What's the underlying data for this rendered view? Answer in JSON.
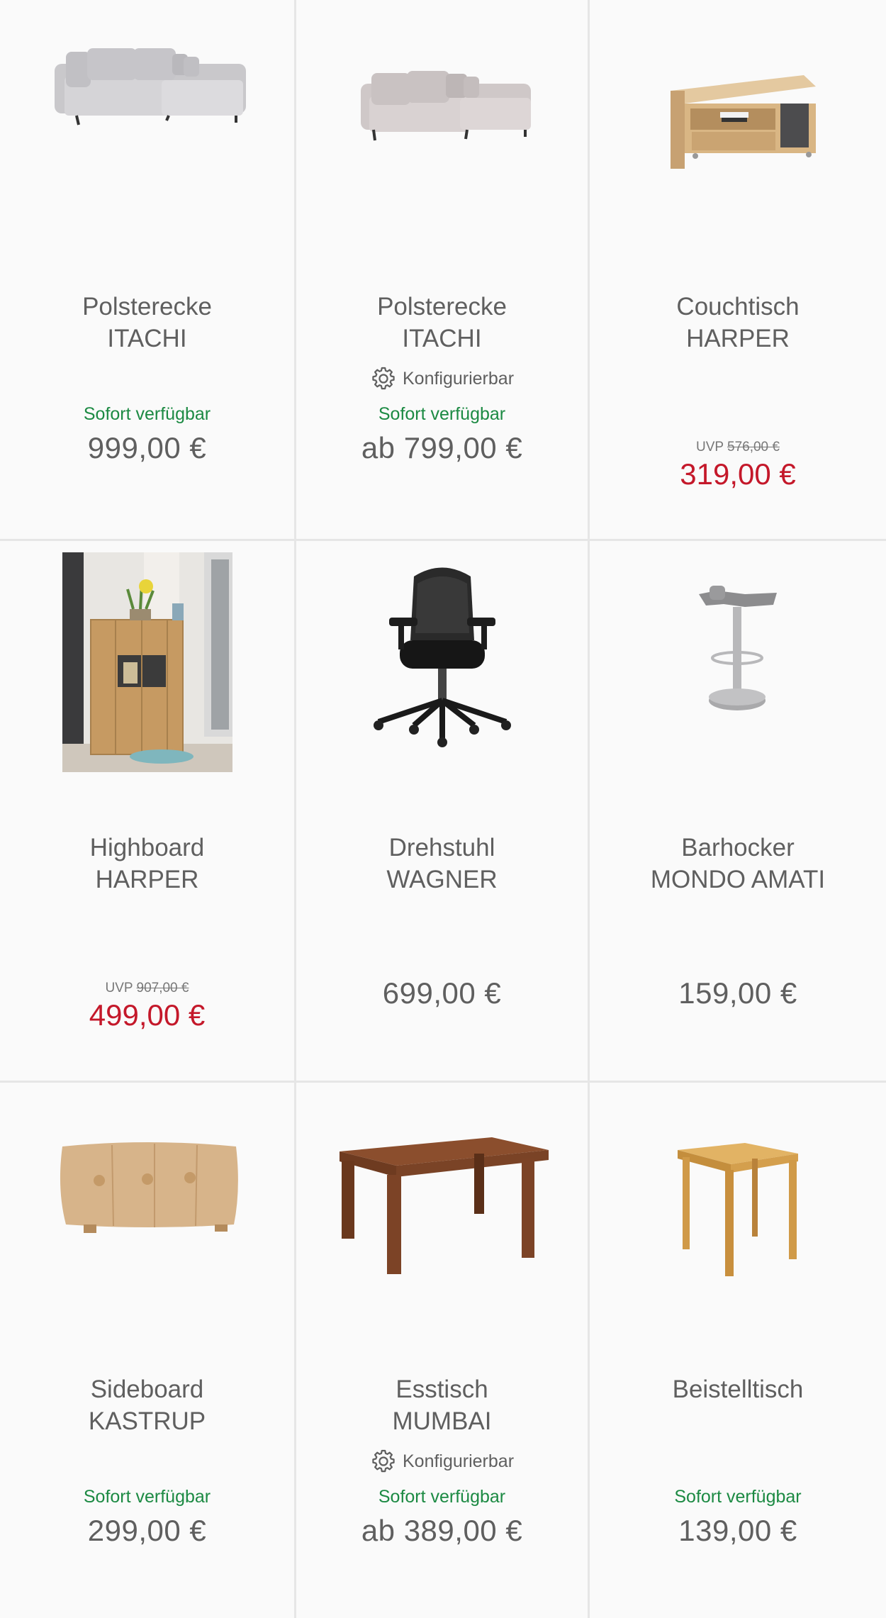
{
  "products": [
    {
      "name_line1": "Polsterecke",
      "name_line2": "ITACHI",
      "config": "",
      "availability": "Sofort verfügbar",
      "price": "999,00 €",
      "uvp_label": "",
      "uvp_price": "",
      "sale_price": ""
    },
    {
      "name_line1": "Polsterecke",
      "name_line2": "ITACHI",
      "config": "Konfigurierbar",
      "availability": "Sofort verfügbar",
      "price": "ab 799,00 €",
      "uvp_label": "",
      "uvp_price": "",
      "sale_price": ""
    },
    {
      "name_line1": "Couchtisch",
      "name_line2": "HARPER",
      "config": "",
      "availability": "",
      "price": "",
      "uvp_label": "UVP",
      "uvp_price": "576,00 €",
      "sale_price": "319,00 €"
    },
    {
      "name_line1": "Highboard",
      "name_line2": "HARPER",
      "config": "",
      "availability": "",
      "price": "",
      "uvp_label": "UVP",
      "uvp_price": "907,00 €",
      "sale_price": "499,00 €"
    },
    {
      "name_line1": "Drehstuhl",
      "name_line2": "WAGNER",
      "config": "",
      "availability": "",
      "price": "699,00 €",
      "uvp_label": "",
      "uvp_price": "",
      "sale_price": ""
    },
    {
      "name_line1": "Barhocker",
      "name_line2": "MONDO AMATI",
      "config": "",
      "availability": "",
      "price": "159,00 €",
      "uvp_label": "",
      "uvp_price": "",
      "sale_price": ""
    },
    {
      "name_line1": "Sideboard",
      "name_line2": "KASTRUP",
      "config": "",
      "availability": "Sofort verfügbar",
      "price": "299,00 €",
      "uvp_label": "",
      "uvp_price": "",
      "sale_price": ""
    },
    {
      "name_line1": "Esstisch",
      "name_line2": "MUMBAI",
      "config": "Konfigurierbar",
      "availability": "Sofort verfügbar",
      "price": "ab 389,00 €",
      "uvp_label": "",
      "uvp_price": "",
      "sale_price": ""
    },
    {
      "name_line1": "Beistelltisch",
      "name_line2": "",
      "config": "",
      "availability": "Sofort verfügbar",
      "price": "139,00 €",
      "uvp_label": "",
      "uvp_price": "",
      "sale_price": ""
    }
  ],
  "colors": {
    "text": "#5f5f5f",
    "available": "#1c8a43",
    "sale": "#c4182a",
    "card_bg": "#fafafa",
    "divider": "#e6e6e6"
  },
  "icons": {
    "config": "gear-icon"
  }
}
